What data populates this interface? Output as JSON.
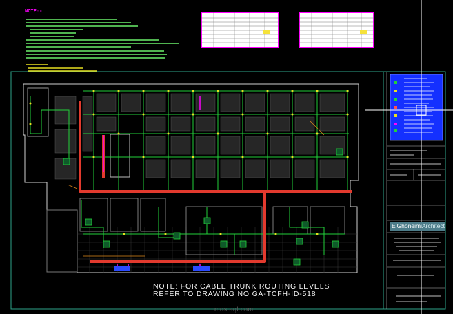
{
  "drawing": {
    "notes_heading": "NOTE:-",
    "bottom_note_line1": "NOTE: FOR CABLE TRUNK ROUTING LEVELS",
    "bottom_note_line2": "REFER TO DRAWING NO GA-TCFH-ID-518",
    "brand_name_part1": "ElGhoneimi",
    "brand_name_part2": "Architects",
    "watermark": "mostaql.com"
  },
  "colors": {
    "background": "#000000",
    "frame": "#2ea58a",
    "trunk": "#e23a2e",
    "cable": "#22d13a",
    "device": "#e8e020",
    "magenta": "#ff00ff",
    "legend_blue": "#1f3dff",
    "cursor": "#ffffff"
  }
}
